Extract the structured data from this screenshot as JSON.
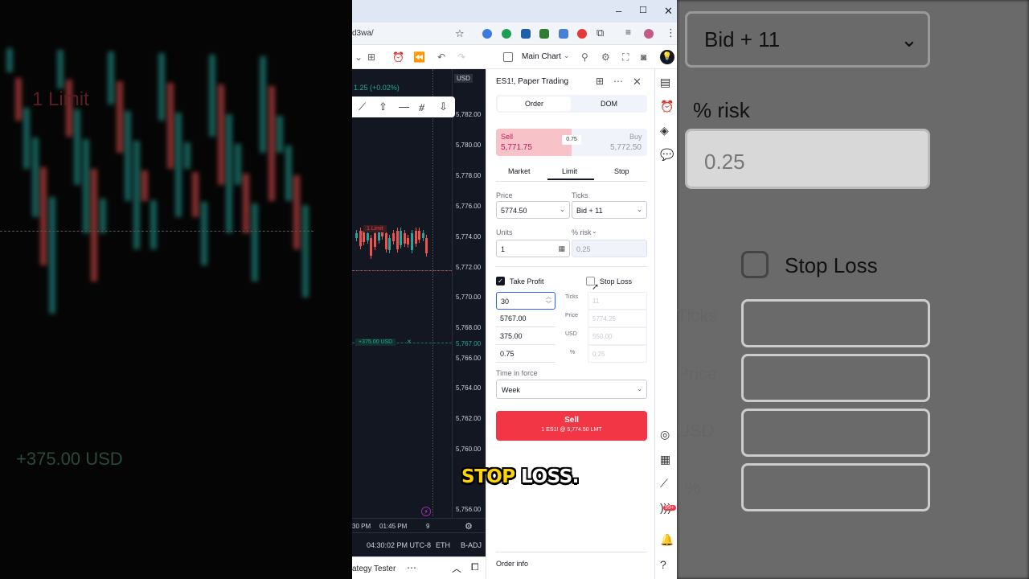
{
  "browser": {
    "url_fragment": "d3wa/",
    "window_controls": [
      "–",
      "☐",
      "✕"
    ]
  },
  "toolbar": {
    "chart_name": "Main Chart"
  },
  "chart": {
    "change_label": "1.25 (+0.02%)",
    "currency": "USD",
    "price_ticks": [
      "5,782.00",
      "5,780.00",
      "5,778.00",
      "5,776.00",
      "5,774.00",
      "5,772.00",
      "5,770.00",
      "5,768.00",
      "5,767.00",
      "5,766.00",
      "5,764.00",
      "5,762.00",
      "5,760.00",
      "5,756.00"
    ],
    "limit_label": "1  Limit",
    "pnl_label": "+375.00 USD",
    "pnl_close": "✕",
    "time_labels": [
      "30 PM",
      "01:45 PM",
      "9"
    ],
    "status": {
      "clock": "04:30:02 PM UTC-8",
      "session": "ETH",
      "adj": "B-ADJ"
    },
    "strategy_tester": "ategy Tester"
  },
  "panel": {
    "title": "ES1!, Paper Trading",
    "tabs": [
      "Order",
      "DOM"
    ],
    "sell_label": "Sell",
    "sell_price": "5,771.75",
    "buy_label": "Buy",
    "buy_price": "5,772.50",
    "spread": "0.75",
    "order_types": [
      "Market",
      "Limit",
      "Stop"
    ],
    "price_label": "Price",
    "price_value": "5774.50",
    "ticks_label": "Ticks",
    "ticks_value": "Bid + 11",
    "units_label": "Units",
    "units_value": "1",
    "risk_label": "% risk",
    "risk_value": "0.25",
    "take_profit_label": "Take Profit",
    "take_profit_checked": true,
    "stop_loss_label": "Stop Loss",
    "stop_loss_checked": false,
    "tp_values": [
      "30",
      "5767.00",
      "375.00",
      "0.75"
    ],
    "sl_row_labels": [
      "Ticks",
      "Price",
      "USD",
      "%"
    ],
    "sl_values": [
      "11",
      "5774.25",
      "550.00",
      "0.25"
    ],
    "tif_label": "Time in force",
    "tif_value": "Week",
    "submit_line1": "Sell",
    "submit_line2": "1 ES1! @ 5,774.50 LMT",
    "order_info": "Order info"
  },
  "rail": {
    "badge": "99+"
  },
  "caption": {
    "highlight": "STOP",
    "rest": " LOSS."
  },
  "backdrop": {
    "right_ticks_value": "Bid + 11",
    "right_risk": "% risk",
    "right_risk_value": "0.25",
    "right_stop_loss": "Stop Loss",
    "right_labels": [
      "Ticks",
      "Price",
      "USD",
      "%"
    ],
    "left_pnl": "+375.00 USD",
    "left_limit": "1  Limit"
  },
  "colors": {
    "sell": "#f23645",
    "sell_light": "#f7c3c9",
    "up": "#26a69a",
    "down": "#ef5350"
  }
}
